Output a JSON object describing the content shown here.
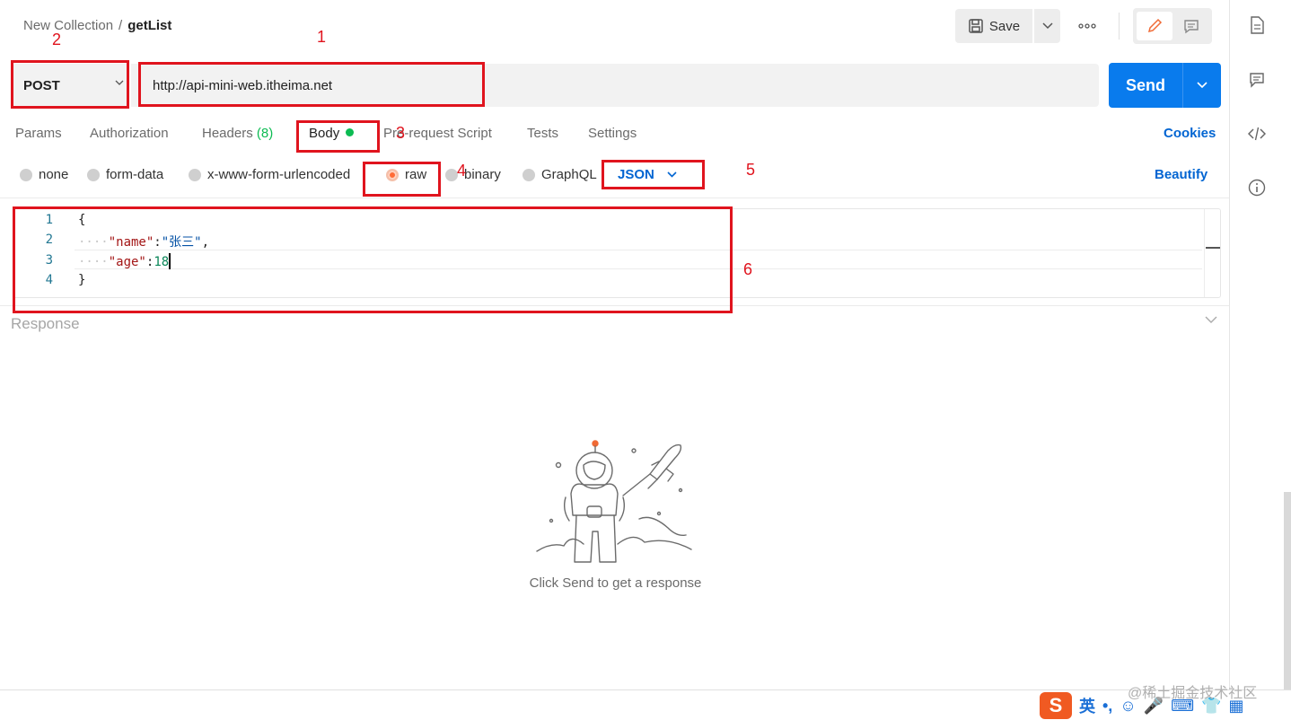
{
  "breadcrumb": {
    "parent": "New Collection",
    "separator": "/",
    "current": "getList"
  },
  "toolbar": {
    "save_label": "Save",
    "more_label": "ooo"
  },
  "request": {
    "method": "POST",
    "url": "http://api-mini-web.itheima.net",
    "send_label": "Send"
  },
  "tabs": [
    {
      "label": "Params"
    },
    {
      "label": "Authorization"
    },
    {
      "label": "Headers",
      "count": "(8)"
    },
    {
      "label": "Body"
    },
    {
      "label": "Pre-request Script"
    },
    {
      "label": "Tests"
    },
    {
      "label": "Settings"
    }
  ],
  "cookies_label": "Cookies",
  "body_types": [
    {
      "label": "none",
      "selected": false
    },
    {
      "label": "form-data",
      "selected": false
    },
    {
      "label": "x-www-form-urlencoded",
      "selected": false
    },
    {
      "label": "raw",
      "selected": true
    },
    {
      "label": "binary",
      "selected": false
    },
    {
      "label": "GraphQL",
      "selected": false
    }
  ],
  "raw_format": "JSON",
  "beautify_label": "Beautify",
  "editor": {
    "line_numbers": [
      "1",
      "2",
      "3",
      "4"
    ],
    "open_brace": "{",
    "close_brace": "}",
    "lines": [
      {
        "indent": "····",
        "key": "\"name\"",
        "colon": ":",
        "value": "\"张三\"",
        "trail": ","
      },
      {
        "indent": "····",
        "key": "\"age\"",
        "colon": ":",
        "value": "18",
        "trail": ""
      }
    ]
  },
  "response": {
    "title": "Response",
    "hint": "Click Send to get a response"
  },
  "annotations": [
    "1",
    "2",
    "3",
    "4",
    "5",
    "6"
  ],
  "ime": {
    "logo": "S",
    "mode": "英",
    "punct": "•,",
    "emoji": "☺",
    "mic": "🎤",
    "keyboard": "⌨",
    "shirt": "👕",
    "grid": "▦"
  },
  "watermark": "@稀土掘金技术社区",
  "colors": {
    "send": "#097bed",
    "link": "#0265d2",
    "active_dot": "#0cbb52",
    "annotation": "#e0141e",
    "radio_on": "#ff6c37"
  }
}
